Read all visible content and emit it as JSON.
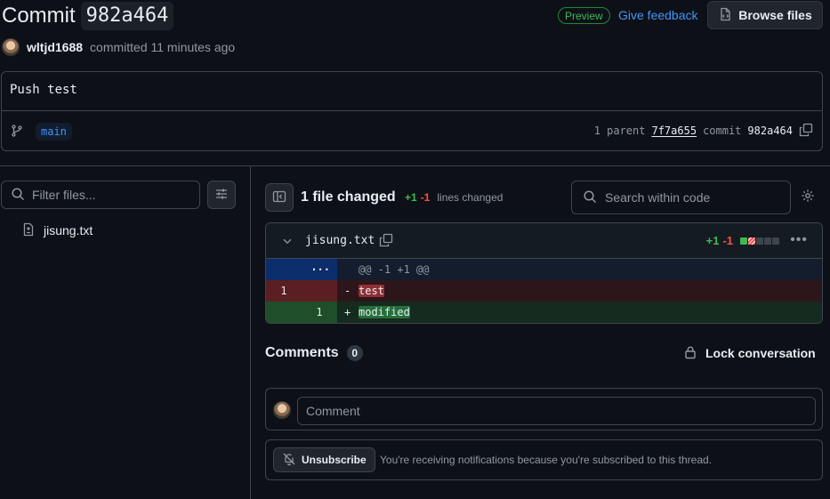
{
  "header": {
    "title_prefix": "Commit",
    "commit_sha": "982a464",
    "preview_label": "Preview",
    "feedback_label": "Give feedback",
    "browse_files_label": "Browse files"
  },
  "author": {
    "name": "wltjd1688",
    "meta": "committed 11 minutes ago"
  },
  "commit": {
    "message": "Push test",
    "branch": "main",
    "parent_count_label": "1 parent",
    "parent_sha": "7f7a655",
    "commit_label": "commit",
    "commit_sha": "982a464"
  },
  "file_tree": {
    "filter_placeholder": "Filter files...",
    "files": [
      "jisung.txt"
    ]
  },
  "diff_summary": {
    "files_changed_label": "1 file changed",
    "additions": "+1",
    "deletions": "-1",
    "lines_changed_label": "lines changed",
    "search_placeholder": "Search within code"
  },
  "diff_file": {
    "name": "jisung.txt",
    "additions": "+1",
    "deletions": "-1",
    "diffstat": [
      "add",
      "del",
      "neutral",
      "neutral",
      "neutral"
    ],
    "hunk_expand": "···",
    "hunk_header": "@@ -1 +1 @@",
    "lines": [
      {
        "type": "del",
        "old": "1",
        "new": "",
        "sign": "-",
        "text": "test"
      },
      {
        "type": "add",
        "old": "",
        "new": "1",
        "sign": "+",
        "text": "modified"
      }
    ]
  },
  "comments": {
    "title": "Comments",
    "count": "0",
    "lock_label": "Lock conversation",
    "comment_placeholder": "Comment",
    "unsubscribe_label": "Unsubscribe",
    "notification_text": "You're receiving notifications because you're subscribed to this thread."
  },
  "colors": {
    "background": "#0d1117",
    "border": "#3d444d",
    "accent_link": "#4493f8",
    "addition": "#3fb950",
    "deletion": "#f85149"
  }
}
